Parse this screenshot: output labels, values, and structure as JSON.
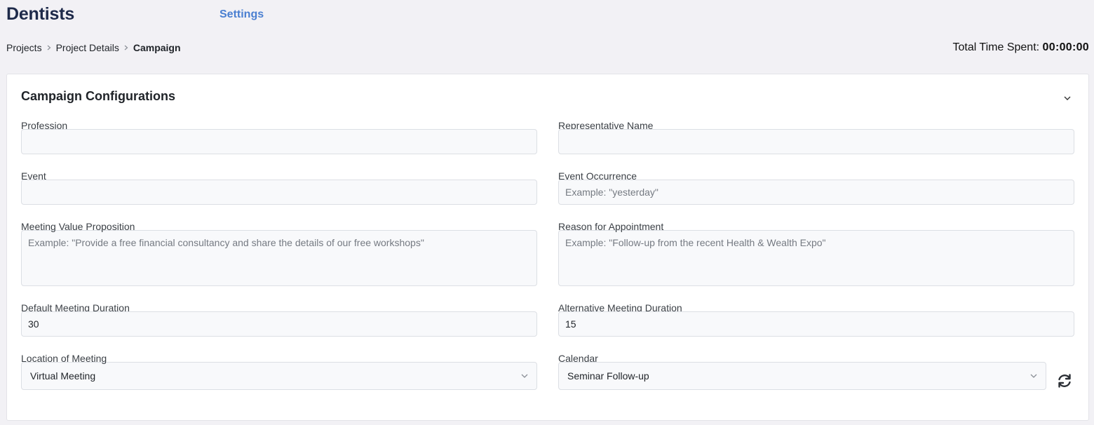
{
  "header": {
    "app_title": "Dentists",
    "settings_label": "Settings"
  },
  "breadcrumb": {
    "items": [
      "Projects",
      "Project Details"
    ],
    "current": "Campaign"
  },
  "timer": {
    "label": "Total Time Spent:",
    "value": "00:00:00"
  },
  "card": {
    "title": "Campaign Configurations",
    "fields": {
      "profession": {
        "label": "Profession",
        "value": "",
        "placeholder": ""
      },
      "representative_name": {
        "label": "Representative Name",
        "value": "",
        "placeholder": ""
      },
      "event": {
        "label": "Event",
        "value": "",
        "placeholder": ""
      },
      "event_occurrence": {
        "label": "Event Occurrence",
        "value": "",
        "placeholder": "Example: \"yesterday\""
      },
      "meeting_value_proposition": {
        "label": "Meeting Value Proposition",
        "value": "",
        "placeholder": "Example: \"Provide a free financial consultancy and share the details of our free workshops\""
      },
      "reason_for_appointment": {
        "label": "Reason for Appointment",
        "value": "",
        "placeholder": "Example: \"Follow-up from the recent Health & Wealth Expo\""
      },
      "default_meeting_duration": {
        "label": "Default Meeting Duration",
        "value": "30"
      },
      "alternative_meeting_duration": {
        "label": "Alternative Meeting Duration",
        "value": "15"
      },
      "location_of_meeting": {
        "label": "Location of Meeting",
        "selected": "Virtual Meeting"
      },
      "calendar": {
        "label": "Calendar",
        "selected": "Seminar Follow-up"
      }
    }
  },
  "icons": {
    "breadcrumb_separator": "chevron-right-icon",
    "collapse": "chevron-down-icon",
    "select": "chevron-down-icon",
    "refresh": "refresh-icon"
  },
  "colors": {
    "app_title": "#1e2a4a",
    "link": "#4a7fd1",
    "background": "#f2f1f5",
    "card": "#ffffff",
    "input_bg": "#f8f9fb"
  }
}
